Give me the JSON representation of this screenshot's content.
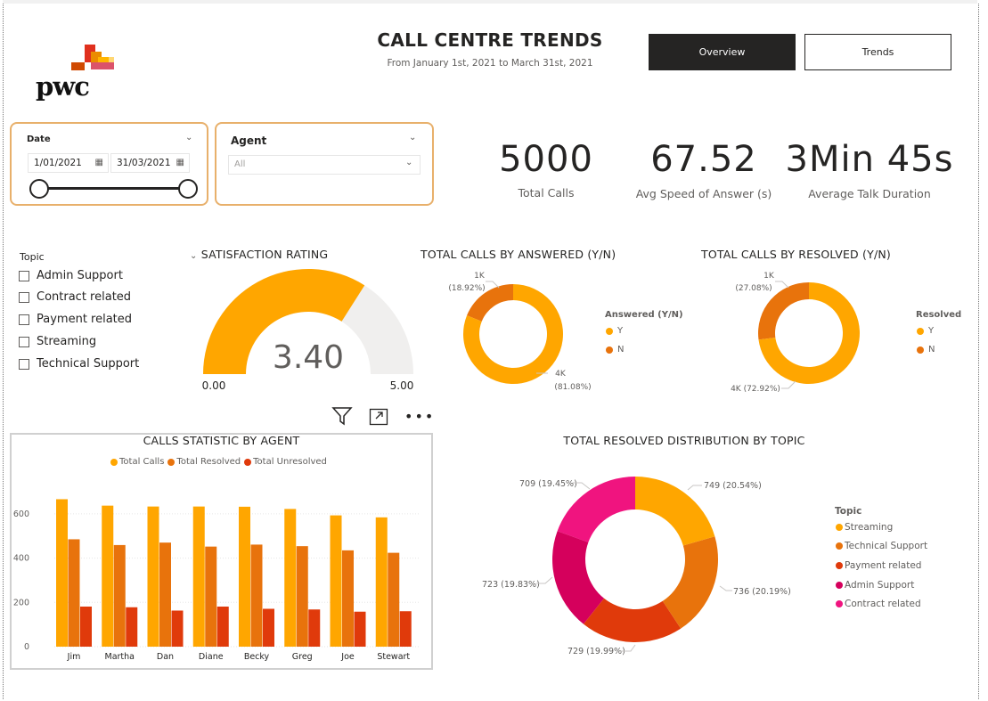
{
  "header": {
    "logo_text": "pwc",
    "title": "CALL CENTRE TRENDS",
    "subtitle": "From January 1st, 2021 to March 31st, 2021",
    "nav": {
      "overview": "Overview",
      "trends": "Trends"
    }
  },
  "slicers": {
    "date": {
      "label": "Date",
      "start": "1/01/2021",
      "end": "31/03/2021"
    },
    "agent": {
      "label": "Agent",
      "value": "All"
    }
  },
  "kpis": [
    {
      "value": "5000",
      "label": "Total Calls"
    },
    {
      "value": "67.52",
      "label": "Avg Speed of Answer (s)"
    },
    {
      "value": "3Min 45s",
      "label": "Average Talk Duration"
    }
  ],
  "topic_filter": {
    "label": "Topic",
    "items": [
      "Admin Support",
      "Contract related",
      "Payment related",
      "Streaming",
      "Technical Support"
    ]
  },
  "colors": {
    "orange": "#ffa600",
    "dark_orange": "#e8730c",
    "red": "#e03a0b",
    "crimson": "#d5005c",
    "pink": "#f0147f",
    "gauge_bg": "#f0efee"
  },
  "chart_data": [
    {
      "type": "gauge",
      "title": "SATISFACTION RATING",
      "value": 3.4,
      "value_label": "3.40",
      "min": 0,
      "max": 5,
      "min_label": "0.00",
      "max_label": "5.00"
    },
    {
      "type": "donut",
      "title": "TOTAL CALLS BY ANSWERED (Y/N)",
      "legend_title": "Answered (Y/N)",
      "slices": [
        {
          "name": "Y",
          "value": 81.08,
          "label1": "4K",
          "label2": "(81.08%)"
        },
        {
          "name": "N",
          "value": 18.92,
          "label1": "1K",
          "label2": "(18.92%)"
        }
      ]
    },
    {
      "type": "donut",
      "title": "TOTAL CALLS BY RESOLVED (Y/N)",
      "legend_title": "Resolved",
      "slices": [
        {
          "name": "Y",
          "value": 72.92,
          "label1": "4K (72.92%)"
        },
        {
          "name": "N",
          "value": 27.08,
          "label1": "1K",
          "label2": "(27.08%)"
        }
      ]
    },
    {
      "type": "bar",
      "title": "CALLS STATISTIC BY AGENT",
      "categories": [
        "Jim",
        "Martha",
        "Dan",
        "Diane",
        "Becky",
        "Greg",
        "Joe",
        "Stewart"
      ],
      "series": [
        {
          "name": "Total Calls",
          "values": [
            666,
            637,
            633,
            633,
            632,
            622,
            593,
            584
          ]
        },
        {
          "name": "Total Resolved",
          "values": [
            485,
            459,
            470,
            452,
            461,
            454,
            435,
            424
          ]
        },
        {
          "name": "Total Unresolved",
          "values": [
            181,
            178,
            163,
            181,
            171,
            168,
            158,
            160
          ]
        }
      ],
      "ylim": [
        0,
        700
      ],
      "yticks": [
        0,
        200,
        400,
        600
      ],
      "ytick_labels": [
        "0",
        "200",
        "400",
        "600"
      ]
    },
    {
      "type": "donut",
      "title": "TOTAL RESOLVED DISTRIBUTION BY TOPIC",
      "legend_title": "Topic",
      "slices": [
        {
          "name": "Streaming",
          "value": 749,
          "label1": "749 (20.54%)"
        },
        {
          "name": "Technical Support",
          "value": 736,
          "label1": "736 (20.19%)"
        },
        {
          "name": "Payment related",
          "value": 729,
          "label1": "729 (19.99%)"
        },
        {
          "name": "Admin Support",
          "value": 723,
          "label1": "723 (19.83%)"
        },
        {
          "name": "Contract related",
          "value": 709,
          "label1": "709 (19.45%)"
        }
      ]
    }
  ]
}
